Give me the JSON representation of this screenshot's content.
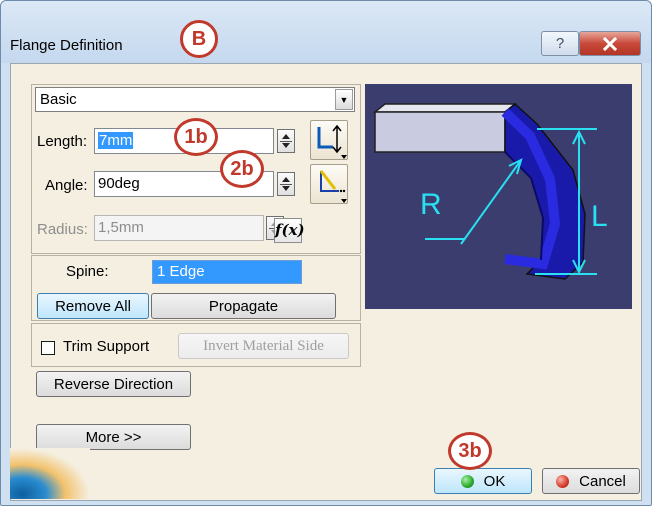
{
  "window": {
    "title": "Flange Definition",
    "help_glyph": "?",
    "close_glyph": "✕"
  },
  "annotations": {
    "b": "B",
    "b1": "1b",
    "b2": "2b",
    "b3": "3b"
  },
  "form": {
    "mode": "Basic",
    "length_label": "Length:",
    "length_value": "7mm",
    "angle_label": "Angle:",
    "angle_value": "90deg",
    "radius_label": "Radius:",
    "radius_value": "1,5mm",
    "fx_label": "f(x)",
    "spine_label": "Spine:",
    "spine_value": "1 Edge"
  },
  "buttons": {
    "remove_all": "Remove All",
    "propagate": "Propagate",
    "trim_support": "Trim Support",
    "invert_material_side": "Invert Material Side",
    "reverse_direction": "Reverse Direction",
    "more": "More >>",
    "ok": "OK",
    "cancel": "Cancel"
  },
  "preview": {
    "radius_symbol": "R",
    "length_symbol": "L"
  },
  "colors": {
    "accent_selection": "#3399ff",
    "annotation_red": "#c0392b",
    "preview_bg": "#3b3d6f",
    "ok_dot": "#2aa82a",
    "cancel_dot": "#d63a2a"
  }
}
